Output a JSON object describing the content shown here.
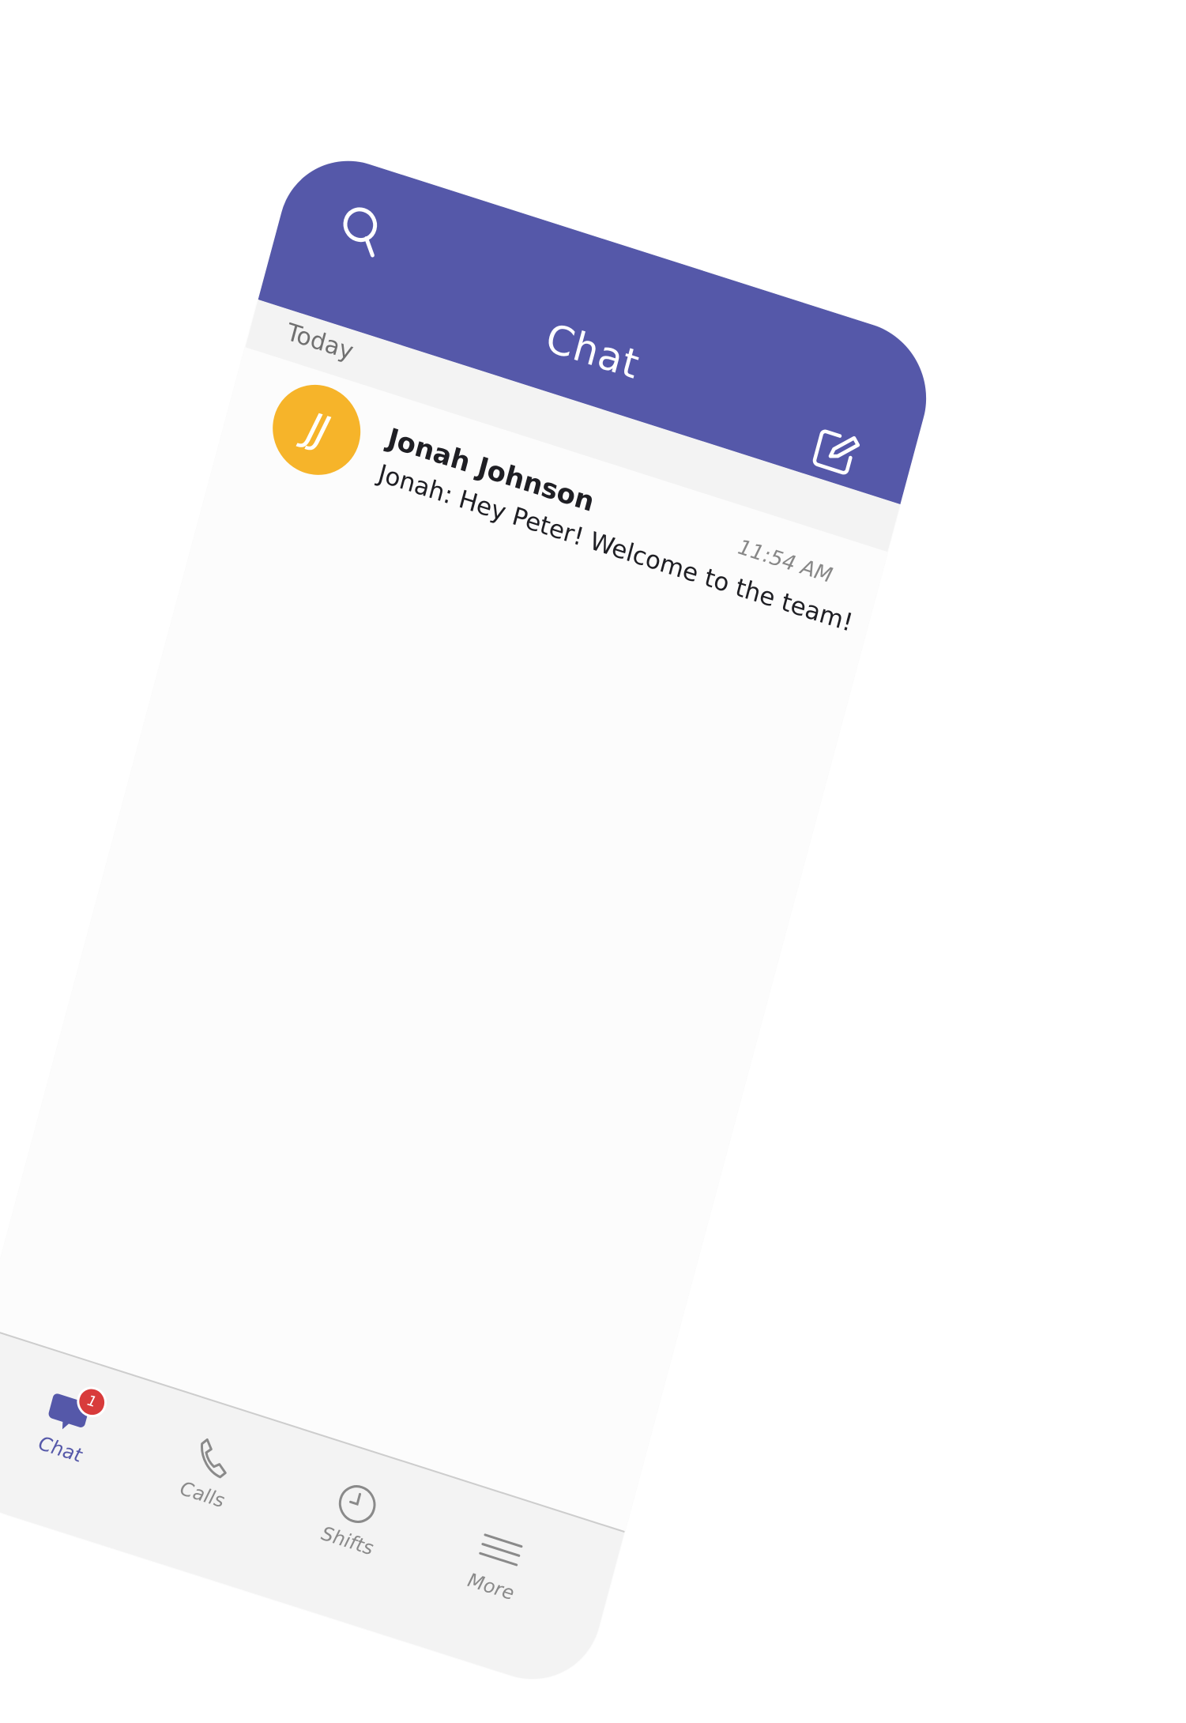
{
  "header": {
    "title": "Chat",
    "search_icon": "search-icon",
    "compose_icon": "compose-icon",
    "background_color": "#5558a9"
  },
  "section": {
    "label": "Today"
  },
  "chats": [
    {
      "initials": "JJ",
      "name": "Jonah Johnson",
      "preview": "Jonah: Hey Peter! Welcome to the team!",
      "time": "11:54 AM",
      "avatar_color": "#f6b42a"
    }
  ],
  "tabbar": {
    "tabs": [
      {
        "label": "Chat",
        "icon": "chat-icon",
        "badge": "1",
        "active": true
      },
      {
        "label": "Calls",
        "icon": "phone-icon",
        "active": false
      },
      {
        "label": "Shifts",
        "icon": "clock-icon",
        "active": false
      },
      {
        "label": "More",
        "icon": "menu-icon",
        "active": false
      }
    ],
    "active_color": "#5558a9",
    "badge_color": "#d83b3b"
  }
}
